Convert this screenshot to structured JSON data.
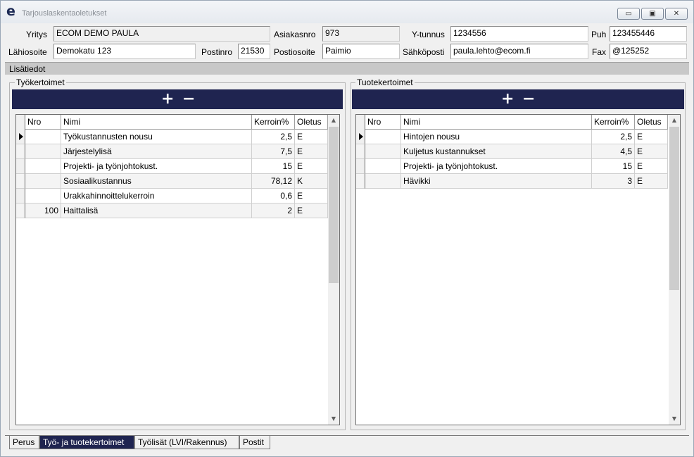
{
  "window": {
    "title": "Tarjouslaskentaoletukset",
    "icon": "e",
    "controls": {
      "minimize": "▭",
      "maximize": "▣",
      "close": "✕"
    }
  },
  "customer": {
    "yritys_label": "Yritys",
    "yritys_value": "ECOM DEMO PAULA",
    "asiakasnro_label": "Asiakasnro",
    "asiakasnro_value": "973",
    "ytunnus_label": "Y-tunnus",
    "ytunnus_value": "1234556",
    "puh_label": "Puh",
    "puh_value": "123455446",
    "lahiosoite_label": "Lähiosoite",
    "lahiosoite_value": "Demokatu 123",
    "postinro_label": "Postinro",
    "postinro_value": "21530",
    "postiosoite_label": "Postiosoite",
    "postiosoite_value": "Paimio",
    "sahkoposti_label": "Sähköposti",
    "sahkoposti_value": "paula.lehto@ecom.fi",
    "fax_label": "Fax",
    "fax_value": "@125252"
  },
  "band_label": "Lisätiedot",
  "tyo": {
    "title": "Työkertoimet",
    "add": "+",
    "remove": "−",
    "headers": {
      "nro": "Nro",
      "nimi": "Nimi",
      "kerroin": "Kerroin%",
      "oletus": "Oletus"
    },
    "rows": [
      {
        "nro": "",
        "nimi": "Työkustannusten nousu",
        "kerroin": "2,5",
        "oletus": "E"
      },
      {
        "nro": "",
        "nimi": "Järjestelylisä",
        "kerroin": "7,5",
        "oletus": "E"
      },
      {
        "nro": "",
        "nimi": "Projekti- ja työnjohtokust.",
        "kerroin": "15",
        "oletus": "E"
      },
      {
        "nro": "",
        "nimi": "Sosiaalikustannus",
        "kerroin": "78,12",
        "oletus": "K"
      },
      {
        "nro": "",
        "nimi": "Urakkahinnoittelukerroin",
        "kerroin": "0,6",
        "oletus": "E"
      },
      {
        "nro": "100",
        "nimi": "Haittalisä",
        "kerroin": "2",
        "oletus": "E"
      }
    ]
  },
  "tuote": {
    "title": "Tuotekertoimet",
    "add": "+",
    "remove": "−",
    "headers": {
      "nro": "Nro",
      "nimi": "Nimi",
      "kerroin": "Kerroin%",
      "oletus": "Oletus"
    },
    "rows": [
      {
        "nro": "",
        "nimi": "Hintojen nousu",
        "kerroin": "2,5",
        "oletus": "E"
      },
      {
        "nro": "",
        "nimi": "Kuljetus kustannukset",
        "kerroin": "4,5",
        "oletus": "E"
      },
      {
        "nro": "",
        "nimi": "Projekti- ja työnjohtokust.",
        "kerroin": "15",
        "oletus": "E"
      },
      {
        "nro": "",
        "nimi": "Hävikki",
        "kerroin": "3",
        "oletus": "E"
      }
    ]
  },
  "tabs": [
    "Perus",
    "Työ- ja tuotekertoimet",
    "Työlisät (LVI/Rakennus)",
    "Postit"
  ],
  "active_tab": "Työ- ja tuotekertoimet",
  "colors": {
    "toolbar": "#1f2450",
    "band": "#c8c8c8",
    "active_tab": "#1f2450"
  }
}
